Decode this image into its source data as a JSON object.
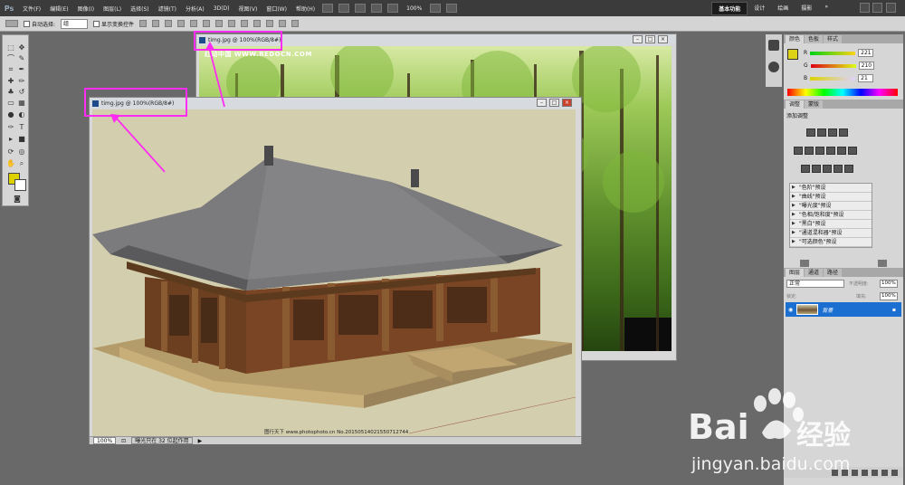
{
  "app": {
    "logo": "Ps"
  },
  "menu": {
    "items": [
      "文件(F)",
      "编辑(E)",
      "图像(I)",
      "图层(L)",
      "选择(S)",
      "滤镜(T)",
      "分析(A)",
      "3D(D)",
      "视图(V)",
      "窗口(W)",
      "帮助(H)"
    ],
    "zoom": "100%"
  },
  "workspaces": {
    "items": [
      "基本功能",
      "设计",
      "绘画",
      "摄影"
    ],
    "active": "基本功能",
    "more": "»"
  },
  "options": {
    "auto_select_label": "自动选择:",
    "auto_select_value": "组",
    "show_transform_label": "显示变换控件"
  },
  "doc_back": {
    "title": "timg.jpg @ 100%(RGB/8#)",
    "watermark_text": "红动中国 WWW.REDOCN.COM"
  },
  "doc_front": {
    "title": "timg.jpg @ 100%(RGB/8#)",
    "credit": "图行天下 www.photophoto.cn  No.20150514021550712744",
    "status_zoom": "100%",
    "status_text": "曝光只在 32 位起作用"
  },
  "panel_color": {
    "tabs": [
      "颜色",
      "色板",
      "样式"
    ],
    "channels": [
      {
        "label": "R",
        "value": "221"
      },
      {
        "label": "G",
        "value": "210"
      },
      {
        "label": "B",
        "value": "21"
      }
    ],
    "foreground": "#ddd215"
  },
  "panel_adjust": {
    "tabs": [
      "调整",
      "蒙版"
    ],
    "heading": "添加调整",
    "presets": [
      "\"色阶\"预设",
      "\"曲线\"预设",
      "\"曝光度\"预设",
      "\"色相/饱和度\"预设",
      "\"黑白\"预设",
      "\"通道混和器\"预设",
      "\"可选颜色\"预设"
    ]
  },
  "panel_layers": {
    "tabs": [
      "图层",
      "通道",
      "路径"
    ],
    "blend_mode": "正常",
    "opacity_label": "不透明度:",
    "opacity_value": "100%",
    "lock_label": "锁定:",
    "fill_label": "填充:",
    "fill_value": "100%",
    "layer_name": "背景"
  },
  "baidu": {
    "brand_left": "Bai",
    "brand_right": "经验",
    "url": "jingyan.baidu.com"
  },
  "colors": {
    "annotation": "#ff2cf1",
    "layer_selected": "#1a6fd0",
    "menubar": "#3b3b3b"
  }
}
